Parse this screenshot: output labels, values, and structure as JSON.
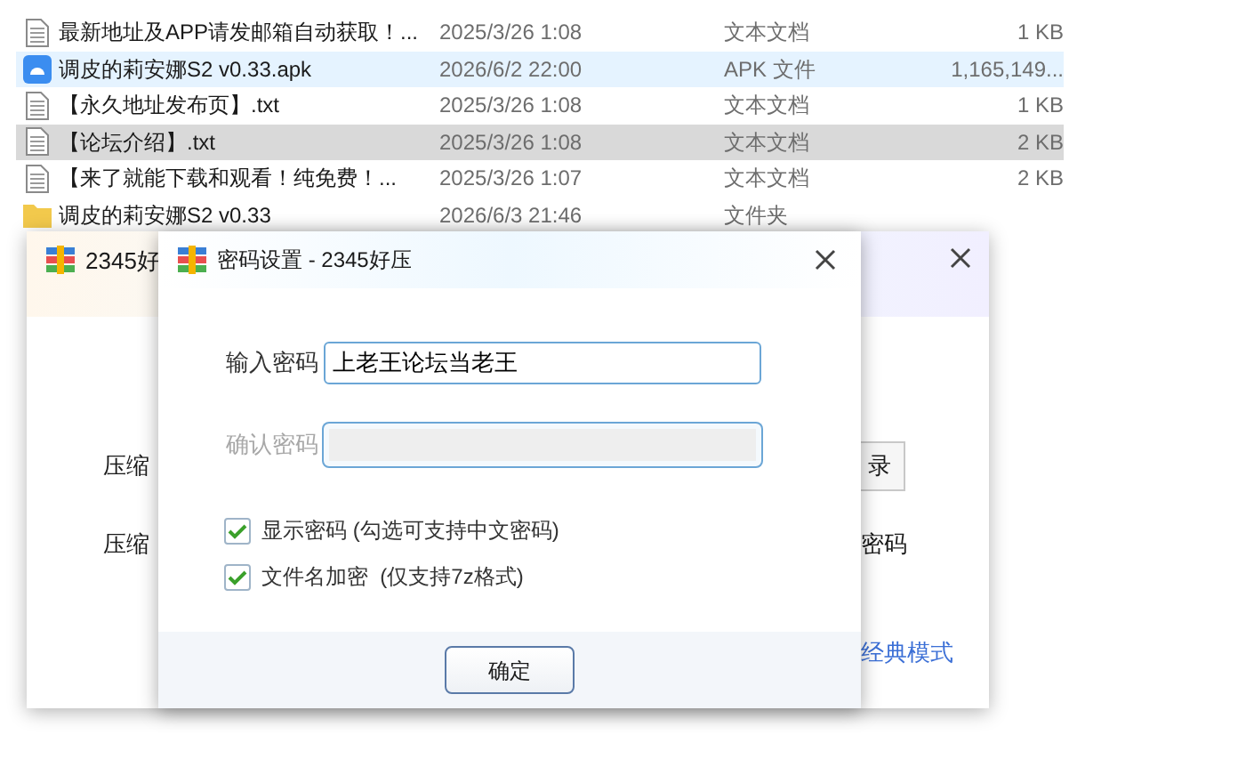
{
  "files": [
    {
      "kind": "txt",
      "name": "最新地址及APP请发邮箱自动获取！...",
      "date": "2025/3/26 1:08",
      "type": "文本文档",
      "size": "1 KB",
      "selected": false,
      "hovered": false
    },
    {
      "kind": "apk",
      "name": "调皮的莉安娜S2 v0.33.apk",
      "date": "2026/6/2 22:00",
      "type": "APK 文件",
      "size": "1,165,149...",
      "selected": false,
      "hovered": true
    },
    {
      "kind": "txt",
      "name": "【永久地址发布页】.txt",
      "date": "2025/3/26 1:08",
      "type": "文本文档",
      "size": "1 KB",
      "selected": false,
      "hovered": false
    },
    {
      "kind": "txt",
      "name": "【论坛介绍】.txt",
      "date": "2025/3/26 1:08",
      "type": "文本文档",
      "size": "2 KB",
      "selected": true,
      "hovered": false
    },
    {
      "kind": "txt",
      "name": "【来了就能下载和观看！纯免费！...",
      "date": "2025/3/26 1:07",
      "type": "文本文档",
      "size": "2 KB",
      "selected": false,
      "hovered": false
    },
    {
      "kind": "folder",
      "name": "调皮的莉安娜S2 v0.33",
      "date": "2026/6/3 21:46",
      "type": "文件夹",
      "selected": false,
      "hovered": false
    }
  ],
  "back_window": {
    "title": "2345好",
    "label_1": "压缩",
    "button": "录",
    "label_2": "压缩",
    "right_text": "密码",
    "link": "经典模式"
  },
  "dialog": {
    "title": "密码设置 - 2345好压",
    "fields": [
      {
        "label": "输入密码",
        "value": "上老王论坛当老王",
        "disabled": false
      },
      {
        "label": "确认密码",
        "disabled": true
      }
    ],
    "options": [
      {
        "label": "显示密码 (勾选可支持中文密码)",
        "checked": true
      },
      {
        "label": "文件名加密  (仅支持7z格式)",
        "checked": true
      }
    ],
    "ok_button": "确定"
  }
}
